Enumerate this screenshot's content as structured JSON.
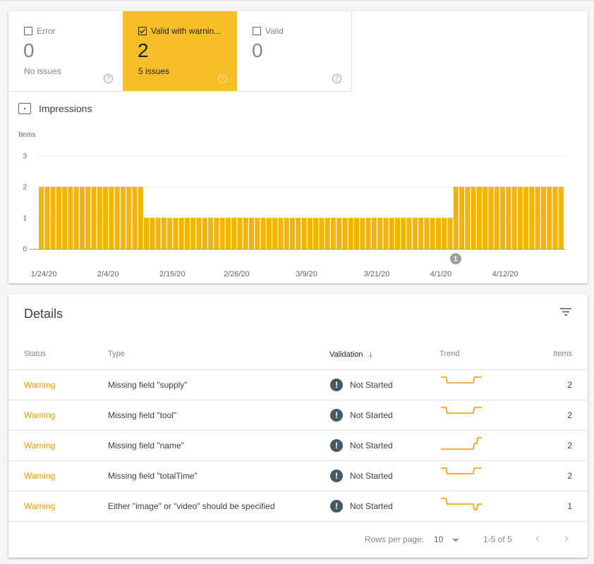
{
  "summary": {
    "tiles": [
      {
        "label": "Error",
        "count": "0",
        "sub": "No issues",
        "checked": false,
        "help": "?"
      },
      {
        "label": "Valid with warnin...",
        "count": "2",
        "sub": "5 issues",
        "checked": true,
        "help": "?"
      },
      {
        "label": "Valid",
        "count": "0",
        "sub": "",
        "checked": false,
        "help": "?"
      }
    ],
    "impressions_label": "Impressions",
    "accent_color": "#f7bf27"
  },
  "chart_data": {
    "type": "bar",
    "title": "",
    "xlabel": "",
    "ylabel": "Items",
    "ylim": [
      0,
      3
    ],
    "yticks": [
      "0",
      "1",
      "2",
      "3"
    ],
    "grid": true,
    "bar_color": "#f4b400",
    "start_date": "1/24/20",
    "xtick_labels": [
      "1/24/20",
      "2/4/20",
      "2/15/20",
      "2/26/20",
      "3/9/20",
      "3/21/20",
      "4/1/20",
      "4/12/20"
    ],
    "xtick_day_index": [
      0,
      11,
      22,
      33,
      45,
      57,
      68,
      79
    ],
    "segments": [
      {
        "value": 2,
        "count": 18
      },
      {
        "value": 1,
        "count": 53
      },
      {
        "value": 2,
        "count": 19
      }
    ],
    "annotation": {
      "label": "1",
      "day_index": 71
    }
  },
  "details": {
    "title": "Details",
    "columns": {
      "status": "Status",
      "type": "Type",
      "validation": "Validation",
      "trend": "Trend",
      "items": "Items"
    },
    "sort_arrow": "↓",
    "rows": [
      {
        "status": "Warning",
        "type": "Missing field \"supply\"",
        "validation": "Not Started",
        "trend": [
          2,
          2,
          1,
          1,
          1,
          1,
          1,
          1,
          1,
          1,
          2,
          2,
          2
        ],
        "items": "2"
      },
      {
        "status": "Warning",
        "type": "Missing field \"tool\"",
        "validation": "Not Started",
        "trend": [
          2,
          2,
          1,
          1,
          1,
          1,
          1,
          1,
          1,
          1,
          2,
          2,
          2
        ],
        "items": "2"
      },
      {
        "status": "Warning",
        "type": "Missing field \"name\"",
        "validation": "Not Started",
        "trend": [
          0,
          0,
          0,
          0,
          0,
          0,
          0,
          0,
          0,
          0,
          1,
          2,
          2
        ],
        "items": "2"
      },
      {
        "status": "Warning",
        "type": "Missing field \"totalTime\"",
        "validation": "Not Started",
        "trend": [
          2,
          2,
          1,
          1,
          1,
          1,
          1,
          1,
          1,
          1,
          2,
          2,
          2
        ],
        "items": "2"
      },
      {
        "status": "Warning",
        "type": "Either \"image\" or \"video\" should be specified",
        "validation": "Not Started",
        "trend": [
          2,
          2,
          1,
          1,
          1,
          1,
          1,
          1,
          1,
          1,
          0,
          1,
          1
        ],
        "items": "1"
      }
    ],
    "validation_icon": "!",
    "warning_color": "#f29900",
    "trend_color": "#f29900"
  },
  "pagination": {
    "rows_per_page_label": "Rows per page:",
    "rows_per_page_value": "10",
    "range": "1-5 of 5",
    "prev": "‹",
    "next": "›"
  }
}
